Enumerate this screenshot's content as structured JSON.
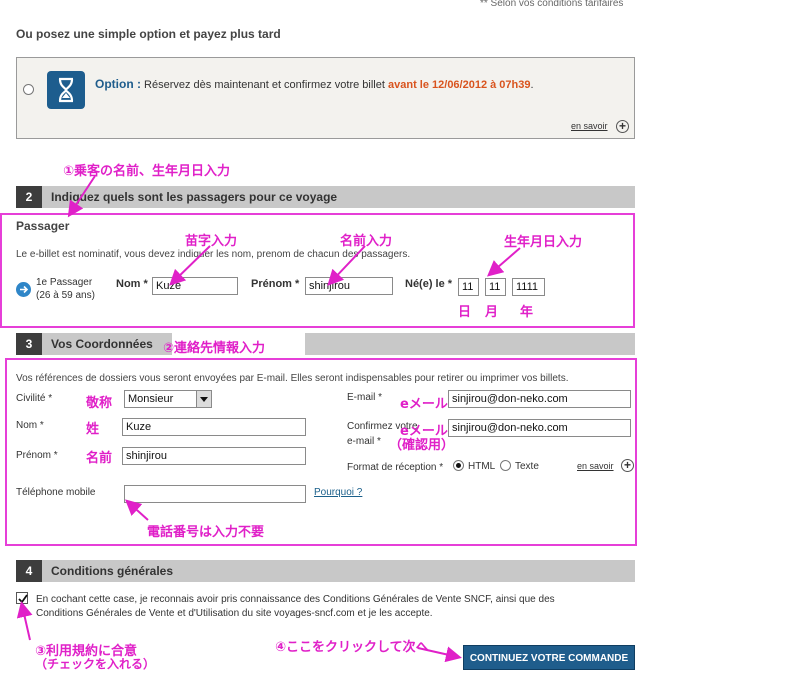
{
  "top_note": "** Selon vos conditions tarifaires",
  "intro_heading": "Ou posez une simple option et payez plus tard",
  "option": {
    "title": "Option :",
    "text": " Réservez dès maintenant et confirmez votre billet ",
    "deadline": "avant le 12/06/2012 à 07h39",
    "period": ".",
    "more_link": "en savoir"
  },
  "section2": {
    "number": "2",
    "title": "Indiquez quels sont les passagers pour ce voyage",
    "subtitle": "Passager",
    "info": "Le e-billet est nominatif, vous devez indiquer les nom, prenom de chacun des passagers.",
    "passenger_label": "1e Passager",
    "passenger_age": "(26 à 59 ans)",
    "nom_label": "Nom *",
    "nom_value": "Kuze",
    "prenom_label": "Prénom *",
    "prenom_value": "shinjirou",
    "dob_label": "Né(e) le *",
    "dob_day": "11",
    "dob_month": "11",
    "dob_year": "1111"
  },
  "section3": {
    "number": "3",
    "title": "Vos Coordonnées",
    "info": "Vos références de dossiers vous seront envoyées par E-mail. Elles seront indispensables pour retirer ou imprimer vos billets.",
    "civilite_label": "Civilité *",
    "civilite_value": "Monsieur",
    "nom_label": "Nom *",
    "nom_value": "Kuze",
    "prenom_label": "Prénom *",
    "prenom_value": "shinjirou",
    "tel_label": "Téléphone mobile",
    "tel_value": "",
    "pourquoi_link": "Pourquoi ?",
    "email_label": "E-mail *",
    "email_value": "sinjirou@don-neko.com",
    "confirm_label_1": "Confirmez votre",
    "confirm_label_2": "e-mail *",
    "confirm_value": "sinjirou@don-neko.com",
    "format_label": "Format de réception *",
    "format_html": "HTML",
    "format_texte": "Texte",
    "more_link": "en savoir"
  },
  "section4": {
    "number": "4",
    "title": "Conditions générales",
    "terms_text_1": "En cochant cette case, je reconnais avoir pris connaissance des Conditions Générales de Vente SNCF, ainsi que des",
    "terms_text_2": "Conditions Générales de Vente et d'Utilisation du site voyages-sncf.com et je les accepte."
  },
  "continue_button": "CONTINUEZ VOTRE COMMANDE",
  "annotations": {
    "a1": "①乗客の名前、生年月日入力",
    "surname": "苗字入力",
    "given": "名前入力",
    "dob": "生年月日入力",
    "day": "日",
    "month": "月",
    "year": "年",
    "a2": "②連絡先情報入力",
    "keisho": "敬称",
    "sei": "姓",
    "namae": "名前",
    "email": "eメール",
    "email2a": "eメール",
    "email2b": "（確認用）",
    "phone_note": "電話番号は入力不要",
    "a3a": "③利用規約に合意",
    "a3b": "（チェックを入れる）",
    "a4": "④ここをクリックして次へ"
  },
  "colors": {
    "annotation": "#e020c8",
    "header_bar": "#c8c8c8",
    "header_num": "#3d3d3d",
    "button": "#1f5d8c",
    "deadline": "#d9541e"
  }
}
